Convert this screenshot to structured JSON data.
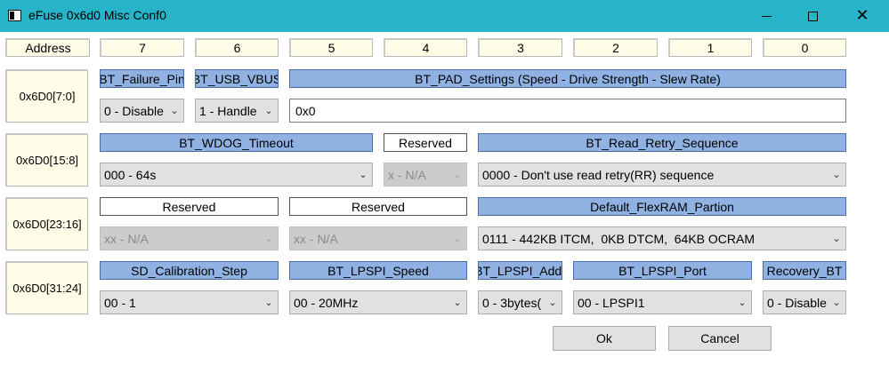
{
  "window": {
    "title": "eFuse 0x6d0 Misc Conf0",
    "min": "—",
    "max": "□",
    "close": "✕"
  },
  "header": {
    "address": "Address",
    "bits": [
      "7",
      "6",
      "5",
      "4",
      "3",
      "2",
      "1",
      "0"
    ]
  },
  "rows": [
    {
      "address": "0x6D0[7:0]",
      "labels": [
        "BT_Failure_Pin",
        "BT_USB_VBUS",
        "BT_PAD_Settings (Speed - Drive Strength - Slew Rate)"
      ],
      "fields": [
        "0 - Disable",
        "1 - Handle",
        "0x0"
      ]
    },
    {
      "address": "0x6D0[15:8]",
      "labels": [
        "BT_WDOG_Timeout",
        "Reserved",
        "BT_Read_Retry_Sequence"
      ],
      "fields": [
        "000 - 64s",
        "x - N/A",
        "0000 - Don't use read retry(RR) sequence"
      ]
    },
    {
      "address": "0x6D0[23:16]",
      "labels": [
        "Reserved",
        "Reserved",
        "Default_FlexRAM_Partion"
      ],
      "fields": [
        "xx - N/A",
        "xx - N/A",
        "0111 - 442KB ITCM,  0KB DTCM,  64KB OCRAM"
      ]
    },
    {
      "address": "0x6D0[31:24]",
      "labels": [
        "SD_Calibration_Step",
        "BT_LPSPI_Speed",
        "BT_LPSPI_Addr",
        "BT_LPSPI_Port",
        "Recovery_BT"
      ],
      "fields": [
        "00 - 1",
        "00 - 20MHz",
        "0 - 3bytes(",
        "00 - LPSPI1",
        "0 - Disable"
      ]
    }
  ],
  "buttons": {
    "ok": "Ok",
    "cancel": "Cancel"
  },
  "icons": {
    "chevron": "chevron-down-icon"
  }
}
